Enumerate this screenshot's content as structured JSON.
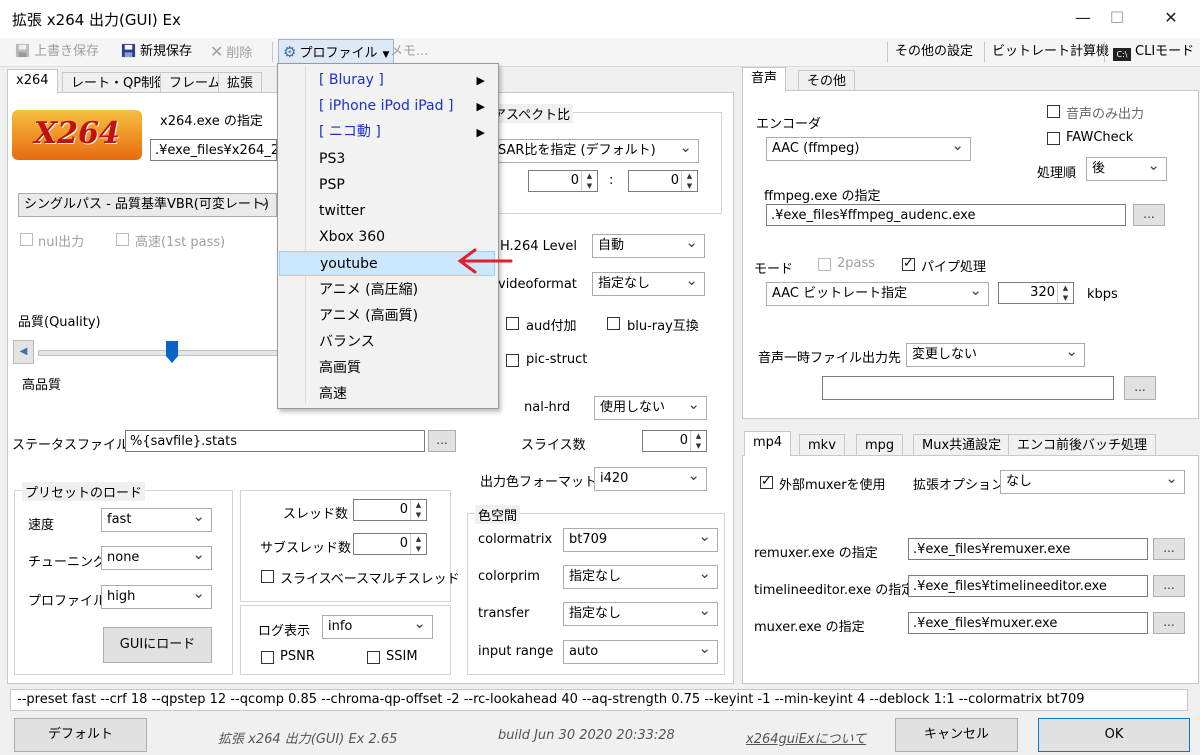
{
  "window": {
    "title": "拡張 x264 出力(GUI) Ex",
    "minimize": "—",
    "maximize": "☐",
    "close": "✕"
  },
  "toolbar": {
    "overwrite_save": "上書き保存",
    "new_save": "新規保存",
    "delete": "削除",
    "profile": "プロファイル",
    "memo": "メモ...",
    "other_settings": "その他の設定",
    "bitrate_calc": "ビットレート計算機",
    "cli_mode": "CLIモード"
  },
  "profile_menu": {
    "items": [
      {
        "label": "[ Bluray ]",
        "submenu": true
      },
      {
        "label": "[ iPhone iPod iPad ]",
        "submenu": true
      },
      {
        "label": "[ ニコ動 ]",
        "submenu": true
      },
      {
        "label": "PS3"
      },
      {
        "label": "PSP"
      },
      {
        "label": "twitter"
      },
      {
        "label": "Xbox 360"
      },
      {
        "label": "youtube",
        "highlighted": true
      },
      {
        "label": "アニメ (高圧縮)"
      },
      {
        "label": "アニメ (高画質)"
      },
      {
        "label": "バランス"
      },
      {
        "label": "高画質"
      },
      {
        "label": "高速"
      }
    ],
    "chevron": "▶"
  },
  "video_tabs": [
    "x264",
    "レート・QP制御",
    "フレーム",
    "拡張"
  ],
  "x264": {
    "logo_text": "X264",
    "exe_label": "x264.exe の指定",
    "exe_path": ".¥exe_files¥x264_2",
    "mode_select": "シングルパス - 品質基準VBR(可変レート)",
    "nul_output": "nul出力",
    "fast_first_pass": "高速(1st pass)",
    "quality_label": "品質(Quality)",
    "high_quality": "高品質",
    "slider_pos_percent": 56,
    "stats_label": "ステータスファイル",
    "stats_value": "%{savfile}.stats",
    "preset_group": "プリセットのロード",
    "speed_label": "速度",
    "speed_value": "fast",
    "tuning_label": "チューニング",
    "tuning_value": "none",
    "profile_label": "プロファイル",
    "profile_value": "high",
    "load_gui": "GUIにロード",
    "threads_label": "スレッド数",
    "threads_value": "0",
    "subthreads_label": "サブスレッド数",
    "subthreads_value": "0",
    "slice_multithread": "スライスベースマルチスレッド",
    "log_label": "ログ表示",
    "log_value": "info",
    "psnr": "PSNR",
    "ssim": "SSIM"
  },
  "x264_right": {
    "aspect_group": "アスペクト比",
    "aspect_select": "SAR比を指定 (デフォルト)",
    "sar_x": "0",
    "sar_sep": ":",
    "sar_y": "0",
    "level_label": "H.264 Level",
    "level_value": "自動",
    "videoformat_label": "videoformat",
    "videoformat_value": "指定なし",
    "aud": "aud付加",
    "bluray": "blu-ray互換",
    "pic_struct": "pic-struct",
    "nal_hrd_label": "nal-hrd",
    "nal_hrd_value": "使用しない",
    "slices_label": "スライス数",
    "slices_value": "0",
    "output_color_label": "出力色フォーマット",
    "output_color_value": "i420",
    "colorspace_group": "色空間",
    "colormatrix_label": "colormatrix",
    "colormatrix_value": "bt709",
    "colorprim_label": "colorprim",
    "colorprim_value": "指定なし",
    "transfer_label": "transfer",
    "transfer_value": "指定なし",
    "input_range_label": "input range",
    "input_range_value": "auto"
  },
  "audio_tabs": [
    "音声",
    "その他"
  ],
  "audio": {
    "encoder_label": "エンコーダ",
    "encoder_value": "AAC (ffmpeg)",
    "audio_only": "音声のみ出力",
    "fawcheck": "FAWCheck",
    "order_label": "処理順",
    "order_value": "後",
    "ffmpeg_label": "ffmpeg.exe の指定",
    "ffmpeg_path": ".¥exe_files¥ffmpeg_audenc.exe",
    "mode_label": "モード",
    "twopass": "2pass",
    "pipe": "パイプ処理",
    "mode_value": "AAC ビットレート指定",
    "bitrate_value": "320",
    "kbps": "kbps",
    "temp_label": "音声一時ファイル出力先",
    "temp_value": "変更しない",
    "temp_path": ""
  },
  "mux_tabs": [
    "mp4",
    "mkv",
    "mpg",
    "Mux共通設定",
    "エンコ前後バッチ処理"
  ],
  "mux": {
    "use_external": "外部muxerを使用",
    "ext_option_label": "拡張オプション",
    "ext_option_value": "なし",
    "remuxer_label": "remuxer.exe の指定",
    "remuxer_path": ".¥exe_files¥remuxer.exe",
    "timeline_label": "timelineeditor.exe の指定",
    "timeline_path": ".¥exe_files¥timelineeditor.exe",
    "muxer_label": "muxer.exe の指定",
    "muxer_path": ".¥exe_files¥muxer.exe",
    "dots": "..."
  },
  "cmdline": "--preset fast --crf 18 --qpstep 12 --qcomp 0.85 --chroma-qp-offset -2 --rc-lookahead 40 --aq-strength 0.75 --keyint -1 --min-keyint 4 --deblock 1:1 --colormatrix bt709",
  "footer": {
    "default": "デフォルト",
    "version": "拡張 x264 出力(GUI) Ex 2.65",
    "build": "build Jun 30 2020 20:33:28",
    "about": "x264guiExについて",
    "cancel": "キャンセル",
    "ok": "OK"
  },
  "colors": {
    "accent_arrow": "#e0202a",
    "submenu_text": "#1a32c8",
    "highlight": "#cce8ff"
  }
}
